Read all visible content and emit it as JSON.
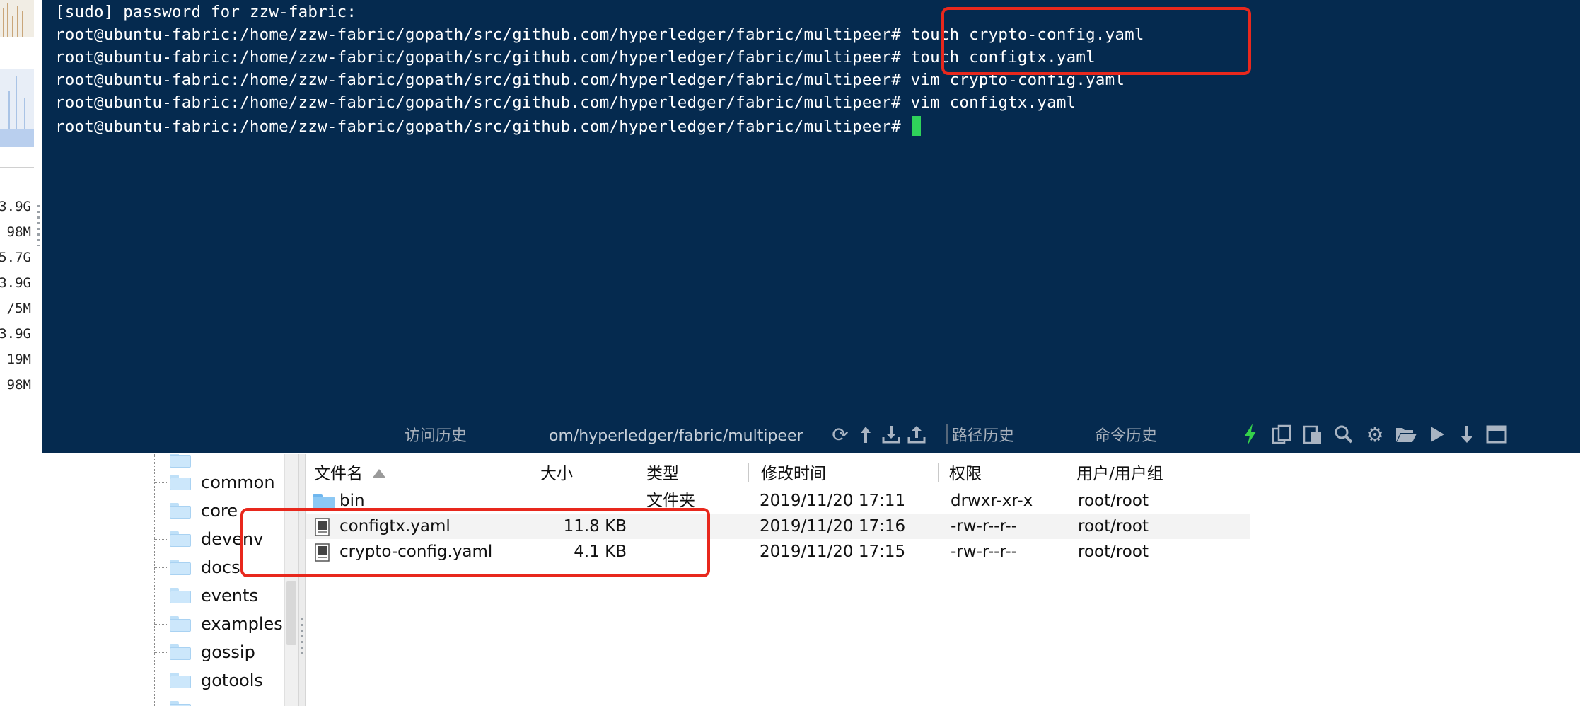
{
  "colors": {
    "terminal_bg": "#052a4f",
    "terminal_text": "#ffffff",
    "cursor": "#2fd25a",
    "highlight": "#e8281d",
    "toolbar_icon": "#a9b4c2",
    "lightning": "#35d14a"
  },
  "sidebar": {
    "memory_items": [
      "3.9G",
      "98M",
      "5.7G",
      "3.9G",
      "/5M",
      "3.9G",
      "19M",
      "98M"
    ]
  },
  "terminal": {
    "lines": [
      "[sudo] password for zzw-fabric:",
      "root@ubuntu-fabric:/home/zzw-fabric/gopath/src/github.com/hyperledger/fabric/multipeer# touch crypto-config.yaml",
      "root@ubuntu-fabric:/home/zzw-fabric/gopath/src/github.com/hyperledger/fabric/multipeer# touch configtx.yaml",
      "root@ubuntu-fabric:/home/zzw-fabric/gopath/src/github.com/hyperledger/fabric/multipeer# vim crypto-config.yaml",
      "root@ubuntu-fabric:/home/zzw-fabric/gopath/src/github.com/hyperledger/fabric/multipeer# vim configtx.yaml",
      "root@ubuntu-fabric:/home/zzw-fabric/gopath/src/github.com/hyperledger/fabric/multipeer# "
    ]
  },
  "toolbar": {
    "history_label": "访问历史",
    "path_value": "om/hyperledger/fabric/multipeer",
    "path_history_label": "路径历史",
    "command_history_label": "命令历史",
    "icons": [
      "refresh-icon",
      "up-directory-icon",
      "download-icon",
      "upload-icon",
      "lightning-icon",
      "copy-icon",
      "paste-icon",
      "search-icon",
      "settings-icon",
      "open-folder-icon",
      "play-icon",
      "download-arrow-icon",
      "window-icon"
    ]
  },
  "tree": {
    "items": [
      "common",
      "core",
      "devenv",
      "docs",
      "events",
      "examples",
      "gossip",
      "gotools"
    ]
  },
  "file_list": {
    "columns": {
      "name": "文件名",
      "size": "大小",
      "type": "类型",
      "modified": "修改时间",
      "permissions": "权限",
      "owner": "用户/用户组"
    },
    "rows": [
      {
        "name": "bin",
        "size": "",
        "type": "文件夹",
        "modified": "2019/11/20 17:11",
        "permissions": "drwxr-xr-x",
        "owner": "root/root",
        "kind": "folder"
      },
      {
        "name": "configtx.yaml",
        "size": "11.8 KB",
        "type": "",
        "modified": "2019/11/20 17:16",
        "permissions": "-rw-r--r--",
        "owner": "root/root",
        "kind": "file"
      },
      {
        "name": "crypto-config.yaml",
        "size": "4.1 KB",
        "type": "",
        "modified": "2019/11/20 17:15",
        "permissions": "-rw-r--r--",
        "owner": "root/root",
        "kind": "file"
      }
    ]
  }
}
